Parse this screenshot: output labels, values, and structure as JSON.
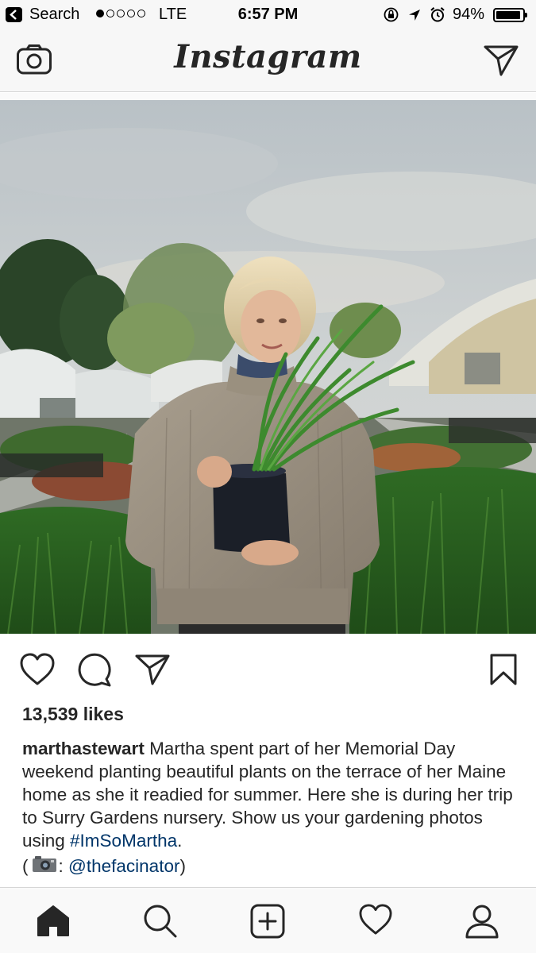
{
  "status_bar": {
    "carrier": "Search",
    "signal_bars_filled": 1,
    "signal_bars_total": 5,
    "network": "LTE",
    "time": "6:57 PM",
    "battery_percent": "94%",
    "battery_level": 0.94,
    "icons": [
      "back-icon",
      "rotation-lock-icon",
      "location-arrow-icon",
      "alarm-icon",
      "battery-icon"
    ]
  },
  "header": {
    "logo": "Instagram",
    "left_icon": "camera-icon",
    "right_icon": "direct-message-icon"
  },
  "post": {
    "actions": [
      "heart-icon",
      "comment-icon",
      "share-icon",
      "bookmark-icon"
    ],
    "likes": "13,539 likes",
    "username": "marthastewart",
    "caption": " Martha spent part of her Memorial Day weekend planting beautiful plants on the terrace of her Maine home as she it readied for summer. Here she is during her trip to Surry Gardens nursery. Show us your gardening photos using ",
    "hashtag": "#ImSoMartha",
    "caption_end": ".",
    "credit_open": "(",
    "credit_sep": ":",
    "credit_mention": "@thefacinator",
    "credit_close": ")"
  },
  "tab_bar": {
    "tabs": [
      "home-icon",
      "search-icon",
      "new-post-icon",
      "activity-icon",
      "profile-icon"
    ],
    "active": "home-icon"
  },
  "colors": {
    "text": "#262626",
    "link": "#003569",
    "bar_background": "#f7f7f7"
  }
}
